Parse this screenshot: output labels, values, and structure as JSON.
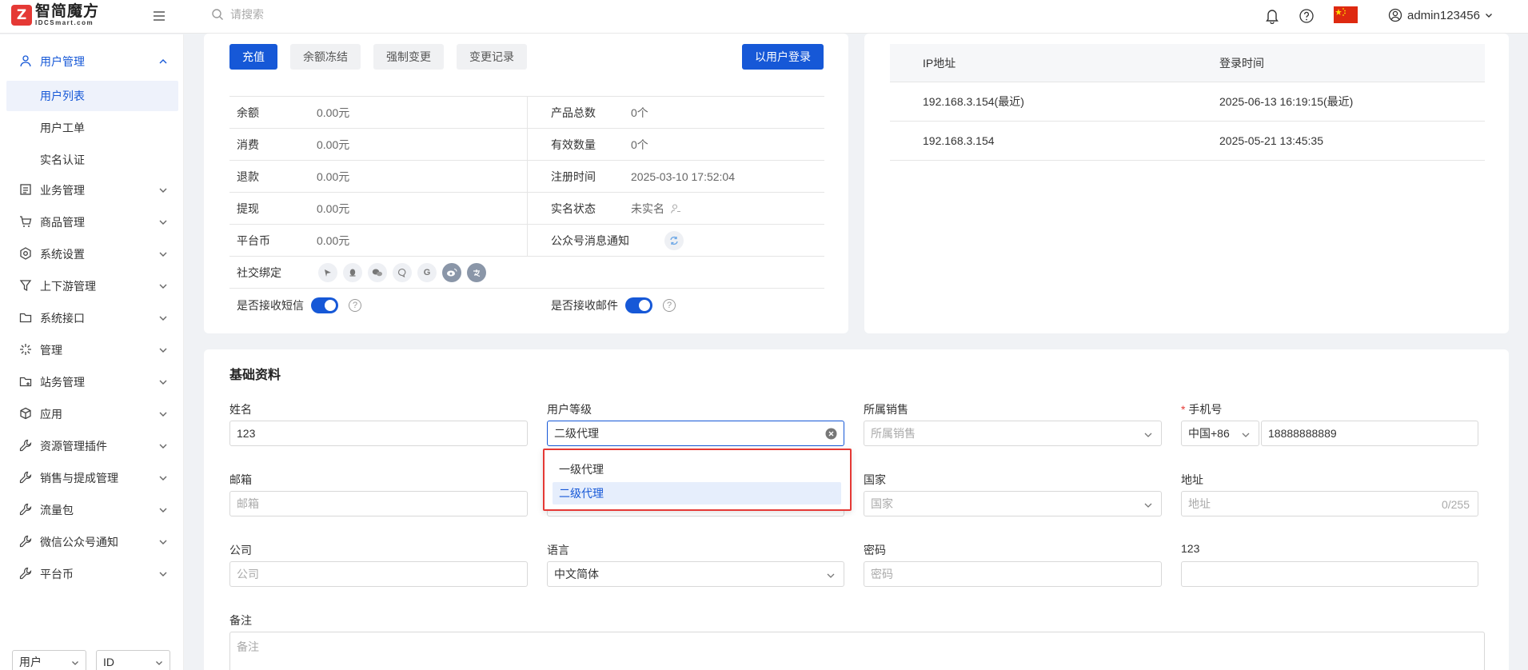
{
  "header": {
    "logo_cn": "智简魔方",
    "logo_en": "IDCSmart.com",
    "search_placeholder": "请搜索",
    "username": "admin123456"
  },
  "sidebar": {
    "groups": [
      {
        "label": "用户管理",
        "icon": "user-icon",
        "expanded": true
      },
      {
        "label": "业务管理",
        "icon": "document-icon"
      },
      {
        "label": "商品管理",
        "icon": "cart-icon"
      },
      {
        "label": "系统设置",
        "icon": "gear-icon"
      },
      {
        "label": "上下游管理",
        "icon": "filter-icon"
      },
      {
        "label": "系统接口",
        "icon": "folder-icon"
      },
      {
        "label": "管理",
        "icon": "sparkle-icon"
      },
      {
        "label": "站务管理",
        "icon": "folder-plus-icon"
      },
      {
        "label": "应用",
        "icon": "cube-icon"
      },
      {
        "label": "资源管理插件",
        "icon": "wrench-icon"
      },
      {
        "label": "销售与提成管理",
        "icon": "wrench-icon"
      },
      {
        "label": "流量包",
        "icon": "wrench-icon"
      },
      {
        "label": "微信公众号通知",
        "icon": "wrench-icon"
      },
      {
        "label": "平台币",
        "icon": "wrench-icon"
      }
    ],
    "sub_items": [
      "用户列表",
      "用户工单",
      "实名认证"
    ],
    "active_sub": "用户列表",
    "footer_select_1": "用户",
    "footer_select_2": "ID"
  },
  "actions": {
    "recharge": "充值",
    "freeze": "余额冻结",
    "force_change": "强制变更",
    "change_log": "变更记录",
    "login_as_user": "以用户登录"
  },
  "account_info": {
    "rows": [
      {
        "k1": "余额",
        "v1": "0.00元",
        "k2": "产品总数",
        "v2": "0个"
      },
      {
        "k1": "消费",
        "v1": "0.00元",
        "k2": "有效数量",
        "v2": "0个"
      },
      {
        "k1": "退款",
        "v1": "0.00元",
        "k2": "注册时间",
        "v2": "2025-03-10 17:52:04"
      },
      {
        "k1": "提现",
        "v1": "0.00元",
        "k2": "实名状态",
        "v2": "未实名"
      },
      {
        "k1": "平台币",
        "v1": "0.00元",
        "k2": "公众号消息通知",
        "v2": ""
      }
    ],
    "social_label": "社交绑定",
    "sms_label": "是否接收短信",
    "email_label": "是否接收邮件",
    "sms_enabled": true,
    "email_enabled": true,
    "help_glyph": "?"
  },
  "login_log": {
    "headers": [
      "IP地址",
      "登录时间"
    ],
    "rows": [
      {
        "ip": "192.168.3.154(最近)",
        "time": "2025-06-13 16:19:15(最近)"
      },
      {
        "ip": "192.168.3.154",
        "time": "2025-05-21 13:45:35"
      }
    ]
  },
  "basic_info": {
    "title": "基础资料",
    "name_label": "姓名",
    "name_value": "123",
    "level_label": "用户等级",
    "level_value": "二级代理",
    "sales_label": "所属销售",
    "sales_placeholder": "所属销售",
    "phone_label": "手机号",
    "phone_required": "*",
    "phone_code": "中国+86",
    "phone_value": "18888888889",
    "email_label": "邮箱",
    "email_placeholder": "邮箱",
    "country_label": "国家",
    "country_placeholder": "国家",
    "address_label": "地址",
    "address_placeholder": "地址",
    "address_counter": "0/255",
    "company_label": "公司",
    "company_placeholder": "公司",
    "language_label": "语言",
    "language_value": "中文简体",
    "password_label": "密码",
    "password_placeholder": "密码",
    "custom_label": "123",
    "custom_value": "",
    "remark_label": "备注",
    "remark_placeholder": "备注"
  },
  "level_dropdown": {
    "options": [
      "一级代理",
      "二级代理"
    ],
    "selected": "二级代理"
  },
  "colors": {
    "primary": "#1658d7",
    "highlight": "#e53935",
    "flag": "#de2910"
  }
}
